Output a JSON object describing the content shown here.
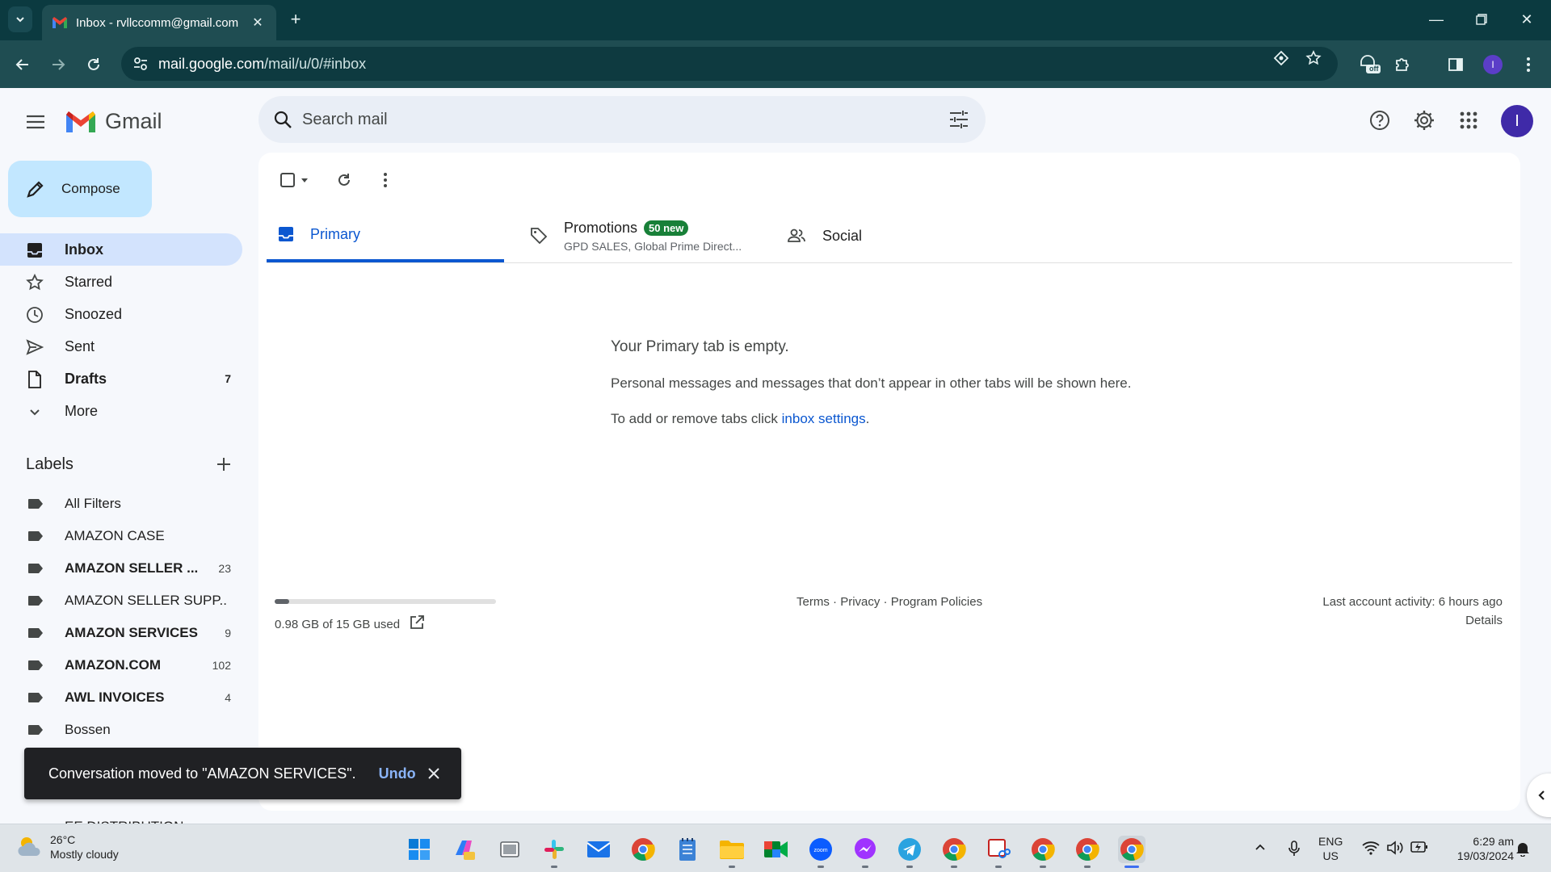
{
  "browser": {
    "tab_title": "Inbox - rvllccomm@gmail.com",
    "url_host": "mail.google.com",
    "url_path": "/mail/u/0/#inbox",
    "profile_initial": "I",
    "extension_badge": "off"
  },
  "header": {
    "app_name": "Gmail",
    "search_placeholder": "Search mail",
    "avatar_initial": "I"
  },
  "sidebar": {
    "compose_label": "Compose",
    "nav": [
      {
        "label": "Inbox",
        "icon": "inbox-icon",
        "count": ""
      },
      {
        "label": "Starred",
        "icon": "star-icon",
        "count": ""
      },
      {
        "label": "Snoozed",
        "icon": "clock-icon",
        "count": ""
      },
      {
        "label": "Sent",
        "icon": "send-icon",
        "count": ""
      },
      {
        "label": "Drafts",
        "icon": "draft-icon",
        "count": "7"
      },
      {
        "label": "More",
        "icon": "chevron-down-icon",
        "count": ""
      }
    ],
    "labels_title": "Labels",
    "labels": [
      {
        "label": "All Filters",
        "count": ""
      },
      {
        "label": "AMAZON CASE",
        "count": ""
      },
      {
        "label": "AMAZON SELLER ...",
        "count": "23"
      },
      {
        "label": "AMAZON SELLER SUPP...",
        "count": ""
      },
      {
        "label": "AMAZON SERVICES",
        "count": "9"
      },
      {
        "label": "AMAZON.COM",
        "count": "102"
      },
      {
        "label": "AWL INVOICES",
        "count": "4"
      },
      {
        "label": "Bossen",
        "count": ""
      }
    ],
    "peek_label": "EE DISTRIBUTION"
  },
  "main": {
    "tabs": {
      "primary": "Primary",
      "promotions": "Promotions",
      "promotions_badge": "50 new",
      "promotions_sub": "GPD SALES, Global Prime Direct...",
      "social": "Social"
    },
    "empty_title": "Your Primary tab is empty.",
    "empty_desc": "Personal messages and messages that don’t appear in other tabs will be shown here.",
    "empty_tabs_prefix": "To add or remove tabs click ",
    "empty_tabs_link": "inbox settings",
    "empty_tabs_suffix": ".",
    "storage_text": "0.98 GB of 15 GB used",
    "storage_fraction": 0.065,
    "footer": {
      "terms": "Terms",
      "sep1": " · ",
      "privacy": "Privacy",
      "sep2": " · ",
      "policies": "Program Policies"
    },
    "last_activity": "Last account activity: 6 hours ago",
    "details": "Details"
  },
  "toast": {
    "message": "Conversation moved to \"AMAZON SERVICES\".",
    "undo": "Undo"
  },
  "taskbar": {
    "temperature": "26°C",
    "weather": "Mostly cloudy",
    "lang_top": "ENG",
    "lang_bottom": "US",
    "time": "6:29 am",
    "date": "19/03/2024"
  },
  "colors": {
    "accent": "#0b57d0",
    "browser_frame": "#1f4d52",
    "compose": "#c2e7ff",
    "active_nav": "#d3e3fd",
    "promo_badge": "#188038"
  }
}
